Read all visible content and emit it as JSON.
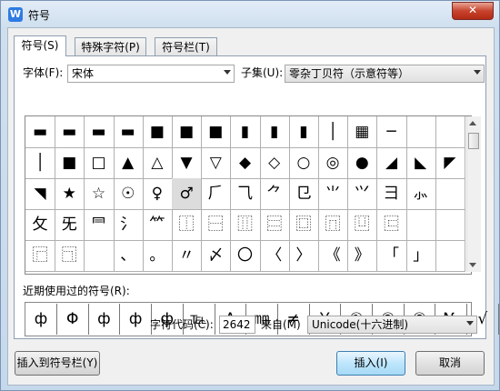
{
  "window": {
    "title": "符号",
    "app_icon_letter": "W",
    "close_glyph": "✕"
  },
  "tabs": [
    {
      "label": "符号(S)",
      "active": true
    },
    {
      "label": "特殊字符(P)",
      "active": false
    },
    {
      "label": "符号栏(T)",
      "active": false
    }
  ],
  "font": {
    "label": "字体(F):",
    "value": "宋体"
  },
  "subset": {
    "label": "子集(U):",
    "value": "零杂丁贝符（示意符等）"
  },
  "symbol_grid": {
    "rows": [
      [
        "▬",
        "▬",
        "▬",
        "▬",
        "■",
        "■",
        "■",
        "▮",
        "▮",
        "▮",
        "│",
        "▦",
        "─"
      ],
      [
        "│",
        "■",
        "□",
        "▲",
        "△",
        "▼",
        "▽",
        "◆",
        "◇",
        "○",
        "◎",
        "●",
        "◢",
        "◣",
        "◤"
      ],
      [
        "◥",
        "★",
        "☆",
        "☉",
        "♀",
        "♂",
        "⺁",
        "⺄",
        "⺈",
        "⺋",
        "⺌",
        "⺍",
        "⺕",
        "⺗"
      ],
      [
        "⺙",
        "⺛",
        "⺜",
        "⺡",
        "⺮",
        "⿰",
        "⿱",
        "⿲",
        "⿳",
        "⿴",
        "⿵",
        "⿶",
        "⿷"
      ],
      [
        "⿸",
        "⿹",
        "",
        "、",
        "。",
        "〃",
        "〆",
        "〇",
        "〈",
        "〉",
        "《",
        "》",
        "「",
        "」"
      ]
    ],
    "selected": {
      "row": 2,
      "col": 5
    }
  },
  "recent": {
    "label": "近期使用过的符号(R):",
    "symbols": [
      "ф",
      "Φ",
      "ф",
      "ф",
      "ф",
      "℡",
      "Δ",
      "㎜",
      "≠",
      "￥",
      "①",
      "②",
      "③",
      "№",
      "√"
    ]
  },
  "char_code": {
    "label": "字符代码(C):",
    "value": "2642"
  },
  "from": {
    "label": "来自(M)",
    "value": "Unicode(十六进制)"
  },
  "buttons": {
    "insert_to_bar": "插入到符号栏(Y)",
    "insert": "插入(I)",
    "cancel": "取消"
  }
}
